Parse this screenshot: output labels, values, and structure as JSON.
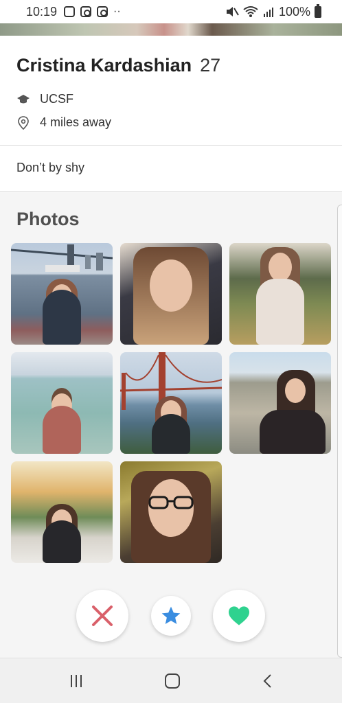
{
  "status_bar": {
    "time": "10:19",
    "battery": "100%"
  },
  "profile": {
    "name": "Cristina Kardashian",
    "age": "27",
    "school": "UCSF",
    "distance": "4 miles away",
    "bio": "Don’t by shy"
  },
  "photos_section": {
    "title": "Photos",
    "photos": [
      {
        "scene": "bridge-water"
      },
      {
        "scene": "car-selfie"
      },
      {
        "scene": "park"
      },
      {
        "scene": "beach"
      },
      {
        "scene": "golden-gate"
      },
      {
        "scene": "river-walk"
      },
      {
        "scene": "vegas"
      },
      {
        "scene": "closeup"
      }
    ]
  },
  "actions": {
    "dislike_icon": "x-icon",
    "superlike_icon": "star-icon",
    "like_icon": "heart-icon"
  },
  "colors": {
    "dislike": "#d9606a",
    "superlike": "#3a8de0",
    "like": "#2fd28f"
  },
  "nav_bar": {
    "recent_icon": "recent-apps-icon",
    "home_icon": "home-icon",
    "back_icon": "back-icon"
  }
}
